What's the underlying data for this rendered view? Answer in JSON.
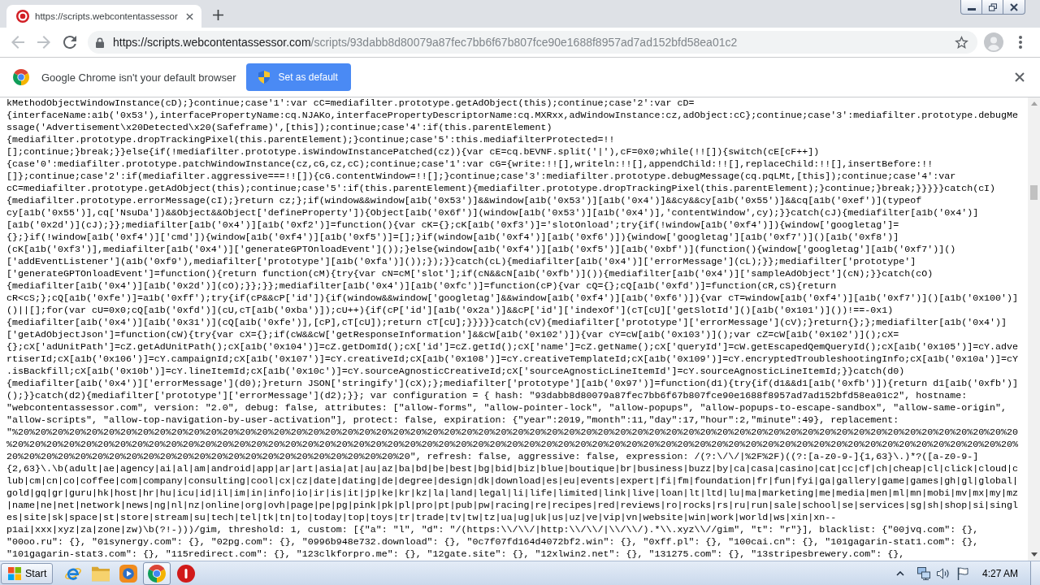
{
  "window": {
    "tabs": [
      {
        "title": "https://scripts.webcontentassessor",
        "selected": true
      }
    ]
  },
  "toolbar": {
    "back_disabled": true,
    "forward_disabled": true,
    "url_host": "https://scripts.webcontentassessor.com",
    "url_path": "/scripts/93dabb8d80079a87fec7bb6f67b807fce90e1688f8957ad7ad152bfd58ea01c2"
  },
  "infobar": {
    "message": "Google Chrome isn't your default browser",
    "button": "Set as default"
  },
  "page_source": {
    "lines": [
      "kMethodObjectWindowInstance(cD);}continue;case'1':var cC=mediafilter.prototype.getAdObject(this);continue;case'2':var cD=",
      "{interfaceName:a1b('0x53'),interfacePropertyName:cq.NJAKo,interfacePropertyDescriptorName:cq.MXRxx,adWindowInstance:cz,adObject:cC};continue;case'3':mediafilter.prototype.debugMe",
      "ssage('Advertisement\\x20Detected\\x20(Safeframe)',[this]);continue;case'4':if(this.parentElement)",
      "{mediafilter.prototype.dropTrackingPixel(this.parentElement);}continue;case'5':this.mediafilterProtected=!!",
      "[];continue;}break;}}else{if(!mediafilter.prototype.isWindowInstancePatched(cz)){var cE=cq.bEVNF.split('|'),cF=0x0;while(!![]){switch(cE[cF++])",
      "{case'0':mediafilter.prototype.patchWindowInstance(cz,cG,cz,cC);continue;case'1':var cG={write:!![],writeln:!![],appendChild:!![],replaceChild:!![],insertBefore:!!",
      "[]};continue;case'2':if(mediafilter.aggressive===!![]){cG.contentWindow=!![];}continue;case'3':mediafilter.prototype.debugMessage(cq.pqLMt,[this]);continue;case'4':var",
      "cC=mediafilter.prototype.getAdObject(this);continue;case'5':if(this.parentElement){mediafilter.prototype.dropTrackingPixel(this.parentElement);}continue;}break;}}}}}catch(cI)",
      "{mediafilter.prototype.errorMessage(cI);}return cz;};if(window&&window[a1b('0x53')]&&window[a1b('0x53')][a1b('0x4')]&&cy&&cy[a1b('0x55')]&&cq[a1b('0xef')](typeof",
      "cy[a1b('0x55')],cq['NsuDa'])&&Object&&Object['defineProperty']){Object[a1b('0x6f')](window[a1b('0x53')][a1b('0x4')],'contentWindow',cy);}}catch(cJ){mediafilter[a1b('0x4')]",
      "[a1b('0x2d')](cJ);}};mediafilter[a1b('0x4')][a1b('0xf2')]=function(){var cK={};cK[a1b('0xf3')]='slotOnload';try{if(!window[a1b('0xf4')]){window['googletag']=",
      "{};}if(!window[a1b('0xf4')]['cmd']){window[a1b('0xf4')][a1b('0xf5')]=[];}if(window[a1b('0xf4')][a1b('0xf6')]){window['googletag'][a1b('0xf7')]()[a1b('0xf8')]",
      "(cK[a1b('0xf3')],mediafilter[a1b('0x4')]['generateGPTOnloadEvent']());}else{window[a1b('0xf4')][a1b('0xf5')][a1b('0xbf')](function(){window['googletag'][a1b('0xf7')]()",
      "['addEventListener'](a1b('0xf9'),mediafilter['prototype'][a1b('0xfa')]());});}}catch(cL){mediafilter[a1b('0x4')]['errorMessage'](cL);}};mediafilter['prototype']",
      "['generateGPTOnloadEvent']=function(){return function(cM){try{var cN=cM['slot'];if(cN&&cN[a1b('0xfb')]()){mediafilter[a1b('0x4')]['sampleAdObject'](cN);}}catch(cO)",
      "{mediafilter[a1b('0x4')][a1b('0x2d')](cO);}};}};mediafilter[a1b('0x4')][a1b('0xfc')]=function(cP){var cQ={};cQ[a1b('0xfd')]=function(cR,cS){return",
      "cR<cS;};cQ[a1b('0xfe')]=a1b('0xff');try{if(cP&&cP['id']){if(window&&window['googletag']&&window[a1b('0xf4')][a1b('0xf6')]){var cT=window[a1b('0xf4')][a1b('0xf7')]()[a1b('0x100')]",
      "()||[];for(var cU=0x0;cQ[a1b('0xfd')](cU,cT[a1b('0xba')]);cU++){if(cP['id'][a1b('0x2a')]&&cP['id']['indexOf'](cT[cU]['getSlotId']()[a1b('0x101')]())!==-0x1)",
      "{mediafilter[a1b('0x4')][a1b('0x31')](cQ[a1b('0xfe')],[cP],cT[cU]);return cT[cU];}}}}}catch(cV){mediafilter['prototype']['errorMessage'](cV);}return{};};mediafilter[a1b('0x4')]",
      "['getAdObjectJson']=function(cW){try{var cX={};if(cW&&cW['getResponseInformation']&&cW[a1b('0x102')]){var cY=cW[a1b('0x103')]();var cZ=cW[a1b('0x102')]();cX=",
      "{};cX['adUnitPath']=cZ.getAdUnitPath();cX[a1b('0x104')]=cZ.getDomId();cX['id']=cZ.getId();cX['name']=cZ.getName();cX['queryId']=cW.getEscapedQemQueryId();cX[a1b('0x105')]=cY.adve",
      "rtiserId;cX[a1b('0x106')]=cY.campaignId;cX[a1b('0x107')]=cY.creativeId;cX[a1b('0x108')]=cY.creativeTemplateId;cX[a1b('0x109')]=cY.encryptedTroubleshootingInfo;cX[a1b('0x10a')]=cY",
      ".isBackfill;cX[a1b('0x10b')]=cY.lineItemId;cX[a1b('0x10c')]=cY.sourceAgnosticCreativeId;cX['sourceAgnosticLineItemId']=cY.sourceAgnosticLineItemId;}}catch(d0)",
      "{mediafilter[a1b('0x4')]['errorMessage'](d0);}return JSON['stringify'](cX);};mediafilter['prototype'][a1b('0x97')]=function(d1){try{if(d1&&d1[a1b('0xfb')]){return d1[a1b('0xfb')]",
      "();}}catch(d2){mediafilter['prototype']['errorMessage'](d2);}}; var configuration = { hash: \"93dabb8d80079a87fec7bb6f67b807fce90e1688f8957ad7ad152bfd58ea01c2\", hostname:",
      "\"webcontentassessor.com\", version: \"2.0\", debug: false, attributes: [\"allow-forms\", \"allow-pointer-lock\", \"allow-popups\", \"allow-popups-to-escape-sandbox\", \"allow-same-origin\",",
      "\"allow-scripts\", \"allow-top-navigation-by-user-activation\"], protect: false, expiration: {\"year\":2019,\"month\":11,\"day\":17,\"hour\":2,\"minute\":49}, replacement:",
      "\"%20%20%20%20%20%20%20%20%20%20%20%20%20%20%20%20%20%20%20%20%20%20%20%20%20%20%20%20%20%20%20%20%20%20%20%20%20%20%20%20%20%20%20%20%20%20%20%20%20%20%20%20%20%20%20%20%20%20%20",
      "%20%20%20%20%20%20%20%20%20%20%20%20%20%20%20%20%20%20%20%20%20%20%20%20%20%20%20%20%20%20%20%20%20%20%20%20%20%20%20%20%20%20%20%20%20%20%20%20%20%20%20%20%20%20%20%20%20%20%20%",
      "20%20%20%20%20%20%20%20%20%20%20%20%20%20%20%20%20%20%20%20%20%20%20%20\", refresh: false, aggressive: false, expression: /(?:\\/\\/|%2F%2F)((?:[a-z0-9-]{1,63}\\.)*?([a-z0-9-]",
      "{2,63}\\.\\b(adult|ae|agency|ai|al|am|android|app|ar|art|asia|at|au|az|ba|bd|be|best|bg|bid|biz|blue|boutique|br|business|buzz|by|ca|casa|casino|cat|cc|cf|ch|cheap|cl|click|cloud|c",
      "lub|cm|cn|co|coffee|com|company|consulting|cool|cx|cz|date|dating|de|degree|design|dk|download|es|eu|events|expert|fi|fm|foundation|fr|fun|fyi|ga|gallery|game|games|gh|gl|global|",
      "gold|gq|gr|guru|hk|host|hr|hu|icu|id|il|im|in|info|io|ir|is|it|jp|ke|kr|kz|la|land|legal|li|life|limited|link|live|loan|lt|ltd|lu|ma|marketing|me|media|men|ml|mn|mobi|mv|mx|my|mz",
      "|name|ne|net|network|news|ng|nl|nz|online|org|ovh|page|pe|pg|pink|pk|pl|pro|pt|pub|pw|racing|re|recipes|red|reviews|ro|rocks|rs|ru|run|sale|school|se|services|sg|sh|shop|si|singl",
      "es|site|sk|space|st|store|stream|su|tech|tel|tk|tn|to|today|top|toys|tr|trade|tv|tw|tz|ua|ug|uk|us|uz|ve|vip|vn|website|win|work|world|ws|xin|xn--",
      "p1ai|xxx|xyz|za|zone|zw)\\b(?!-)))/gim, threshold: 1, custom: [{\"a\": \"l\", \"d\": \"/(https:\\\\/\\\\/|http:\\\\/\\\\/|\\\\/\\\\/).*\\\\.xyz\\\\//gim\", \"t\": \"r\"}], blacklist: {\"00jvq.com\": {},",
      "\"00oo.ru\": {}, \"01synergy.com\": {}, \"02pg.com\": {}, \"0996b948e732.download\": {}, \"0c7f07fd164d4072bf2.win\": {}, \"0xff.pl\": {}, \"100cai.cn\": {}, \"101gagarin-stat1.com\": {},",
      "\"101gagarin-stat3.com\": {}, \"115redirect.com\": {}, \"123clkforpro.me\": {}, \"12gate.site\": {}, \"12xlwin2.net\": {}, \"131275.com\": {}, \"13stripesbrewery.com\": {},"
    ]
  },
  "taskbar": {
    "start": "Start",
    "apps": [
      {
        "kind": "ie",
        "selected": false
      },
      {
        "kind": "folder",
        "selected": false
      },
      {
        "kind": "media",
        "selected": false
      },
      {
        "kind": "chrome",
        "selected": true
      },
      {
        "kind": "record",
        "selected": false
      }
    ],
    "clock": "4:27 AM"
  }
}
